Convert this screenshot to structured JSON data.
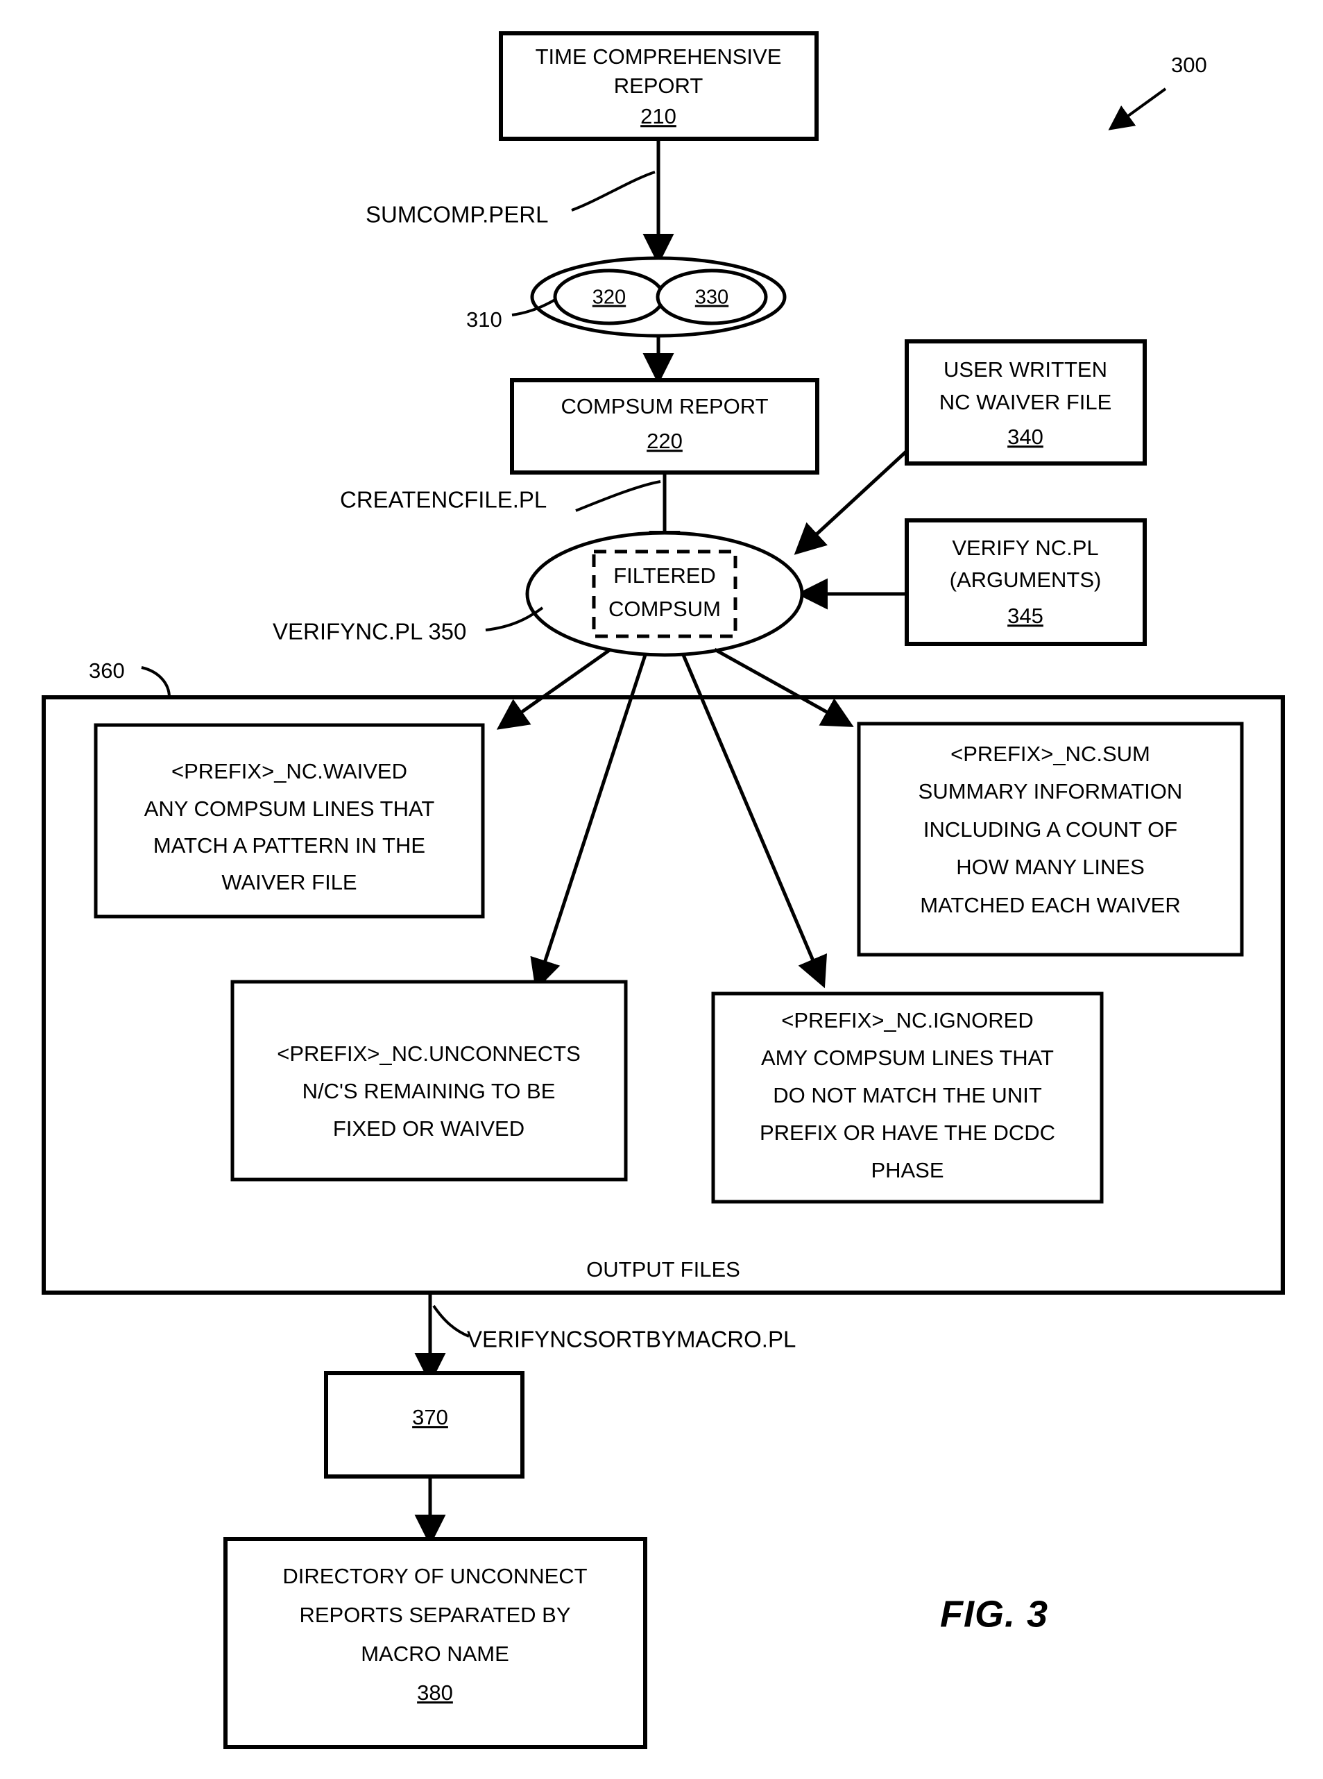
{
  "figure": {
    "label": "FIG. 3",
    "overall_ref": "300"
  },
  "nodes": {
    "time_comprehensive_report": {
      "line1": "TIME COMPREHENSIVE",
      "line2": "REPORT",
      "ref": "210"
    },
    "dual_ellipse": {
      "ref": "310",
      "left_ref": "320",
      "right_ref": "330"
    },
    "compsum_report": {
      "line1": "COMPSUM REPORT",
      "ref": "220"
    },
    "user_written_waiver": {
      "line1": "USER WRITTEN",
      "line2": "NC WAIVER FILE",
      "ref": "340"
    },
    "verify_nc_pl_args": {
      "line1": "VERIFY NC.PL",
      "line2": "(ARGUMENTS)",
      "ref": "345"
    },
    "filtered_compsum": {
      "line1": "FILTERED",
      "line2": "COMPSUM"
    },
    "nc_waived": {
      "line1": "<PREFIX>_NC.WAIVED",
      "line2": "ANY COMPSUM LINES THAT",
      "line3": "MATCH A PATTERN IN THE",
      "line4": "WAIVER FILE"
    },
    "nc_sum": {
      "line1": "<PREFIX>_NC.SUM",
      "line2": "SUMMARY INFORMATION",
      "line3": "INCLUDING A COUNT OF",
      "line4": "HOW MANY LINES",
      "line5": "MATCHED EACH WAIVER"
    },
    "nc_unconnects": {
      "line1": "<PREFIX>_NC.UNCONNECTS",
      "line2": "N/C'S REMAINING TO BE",
      "line3": "FIXED OR WAIVED"
    },
    "nc_ignored": {
      "line1": "<PREFIX>_NC.IGNORED",
      "line2": "AMY COMPSUM LINES THAT",
      "line3": "DO NOT MATCH THE UNIT",
      "line4": "PREFIX OR HAVE THE DCDC",
      "line5": "PHASE"
    },
    "output_files_container": {
      "caption": "OUTPUT FILES",
      "ref": "360"
    },
    "sorted_node": {
      "ref": "370"
    },
    "directory_of_unconnect": {
      "line1": "DIRECTORY OF UNCONNECT",
      "line2": "REPORTS SEPARATED BY",
      "line3": "MACRO NAME",
      "ref": "380"
    }
  },
  "edge_labels": {
    "sumcomp": "SUMCOMP.PERL",
    "createncfile": "CREATENCFILE.PL",
    "verifync": "VERIFYNC.PL 350",
    "verifyncsortbymacro": "VERIFYNCSORTBYMACRO.PL"
  },
  "colors": {
    "stroke": "#000000",
    "fill": "#ffffff"
  }
}
